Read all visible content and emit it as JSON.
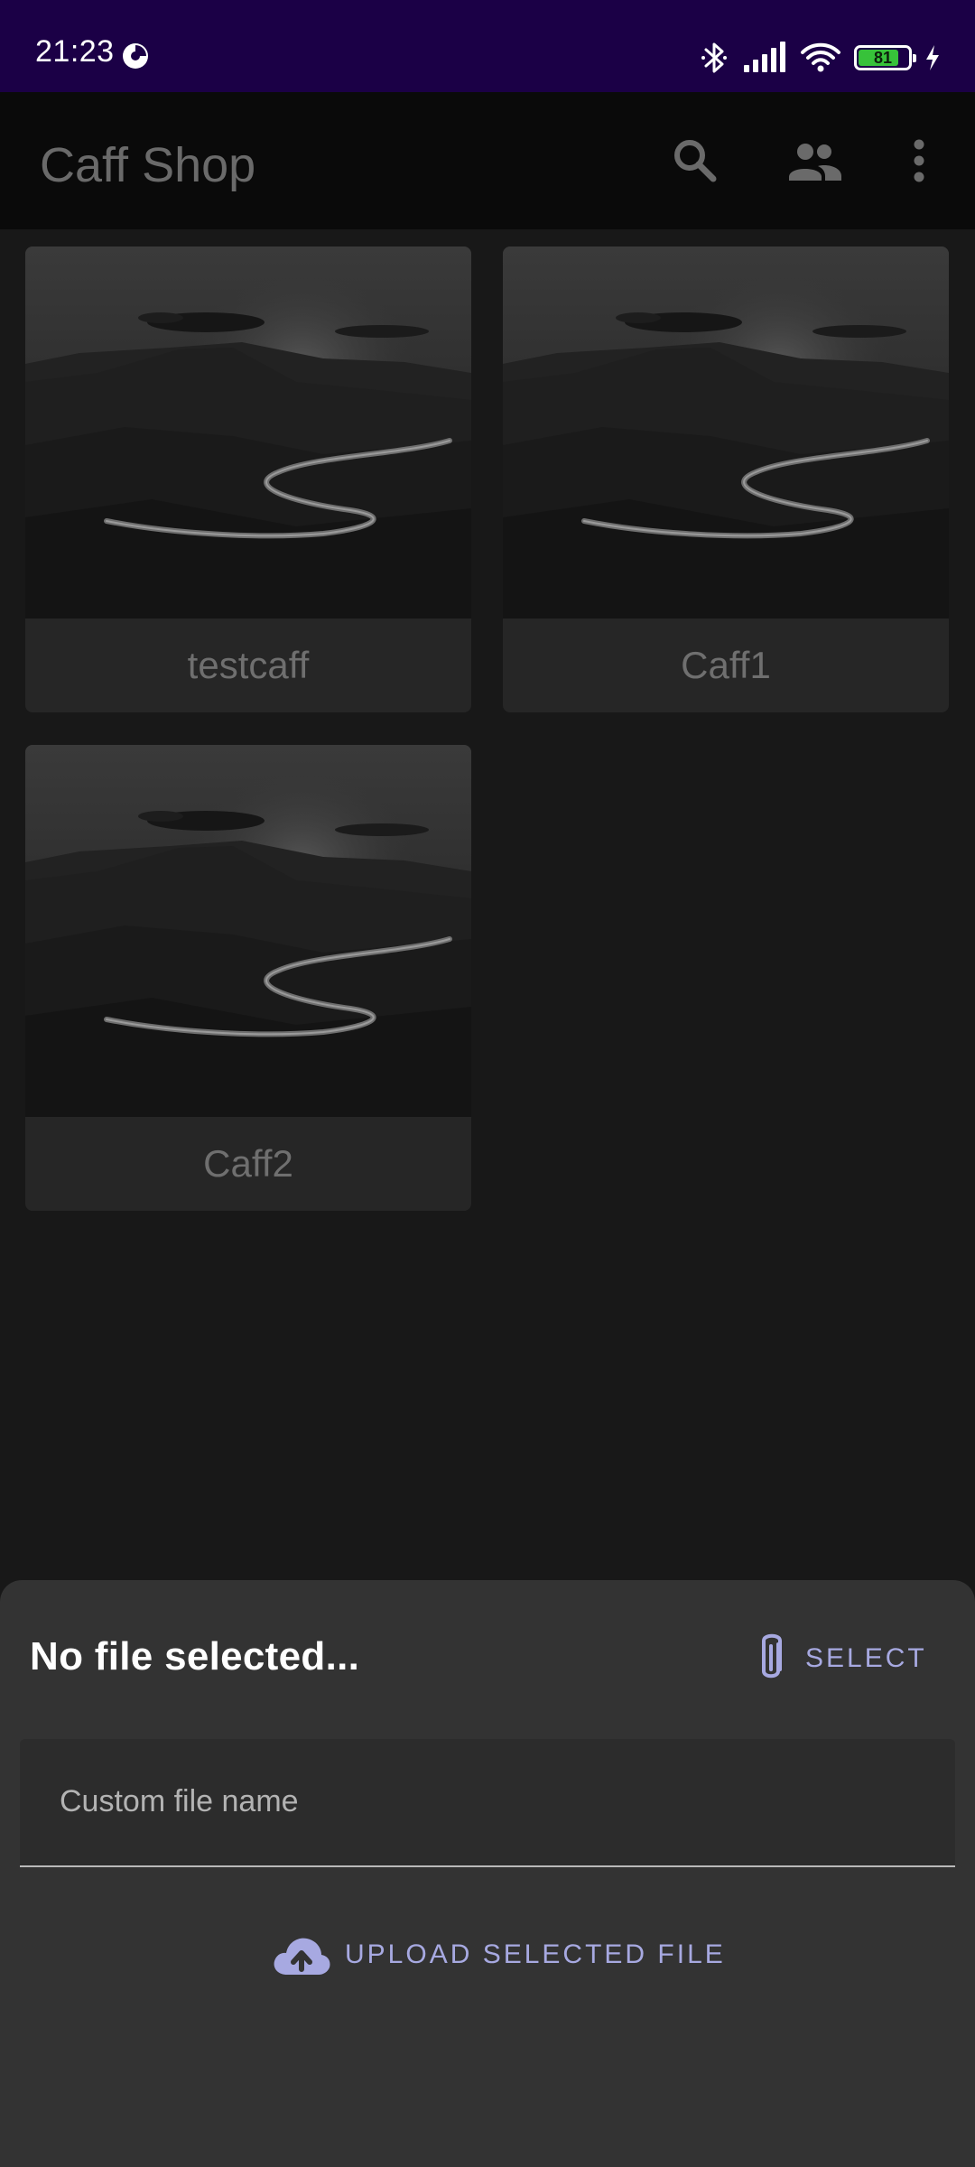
{
  "status_bar": {
    "time": "21:23",
    "battery_level": "81",
    "battery_fraction": 0.81,
    "icons": [
      "data-saver-icon",
      "bluetooth-icon",
      "signal-icon",
      "wifi-icon",
      "battery-icon",
      "charging-icon"
    ]
  },
  "app_bar": {
    "title": "Caff Shop",
    "actions": [
      "search-icon",
      "users-icon",
      "more-vert-icon"
    ]
  },
  "grid": {
    "items": [
      {
        "label": "testcaff"
      },
      {
        "label": "Caff1"
      },
      {
        "label": "Caff2"
      }
    ]
  },
  "sheet": {
    "file_status": "No file selected...",
    "select_label": "SELECT",
    "custom_name_placeholder": "Custom file name",
    "upload_label": "UPLOAD SELECTED FILE"
  },
  "colors": {
    "status_bar_bg": "#1b0046",
    "accent": "#a7a9e1",
    "sheet_bg": "#333333",
    "battery_fill": "#37c23a"
  }
}
